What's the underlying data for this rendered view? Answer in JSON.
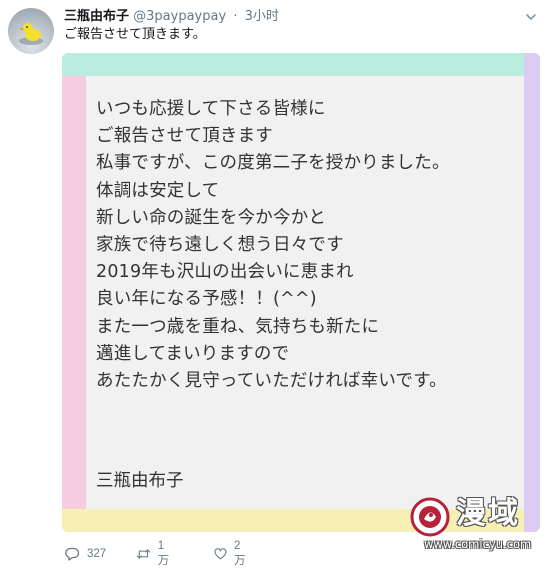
{
  "tweet": {
    "display_name": "三瓶由布子",
    "handle": "@3paypaypay",
    "separator": "·",
    "time": "3小时",
    "text": "ご報告させて頂きます。"
  },
  "image": {
    "letter_lines": [
      "いつも応援して下さる皆様に",
      "ご報告させて頂きます",
      "私事ですが、この度第二子を授かりました。",
      "体調は安定して",
      "新しい命の誕生を今か今かと",
      "家族で待ち遠しく想う日々です",
      "2019年も沢山の出会いに恵まれ",
      "良い年になる予感！！(^^)",
      "また一つ歳を重ね、気持ちも新たに",
      "邁進してまいりますので",
      "あたたかく見守っていただければ幸いです。"
    ],
    "signature": "三瓶由布子",
    "band_colors": {
      "top": "#b9eede",
      "left": "#f7cce0",
      "right": "#dcccf3",
      "bottom": "#f6f0b4"
    }
  },
  "watermark": {
    "title": "漫域",
    "url": "www.comicyu.com",
    "accent": "#b5223a"
  },
  "actions": {
    "reply_count": "327",
    "retweet_count": "1万",
    "like_count": "2万",
    "icons": [
      "reply-icon",
      "retweet-icon",
      "like-icon"
    ]
  },
  "colors": {
    "text": "#14171a",
    "muted": "#657786",
    "paper": "#f1f1f1"
  }
}
